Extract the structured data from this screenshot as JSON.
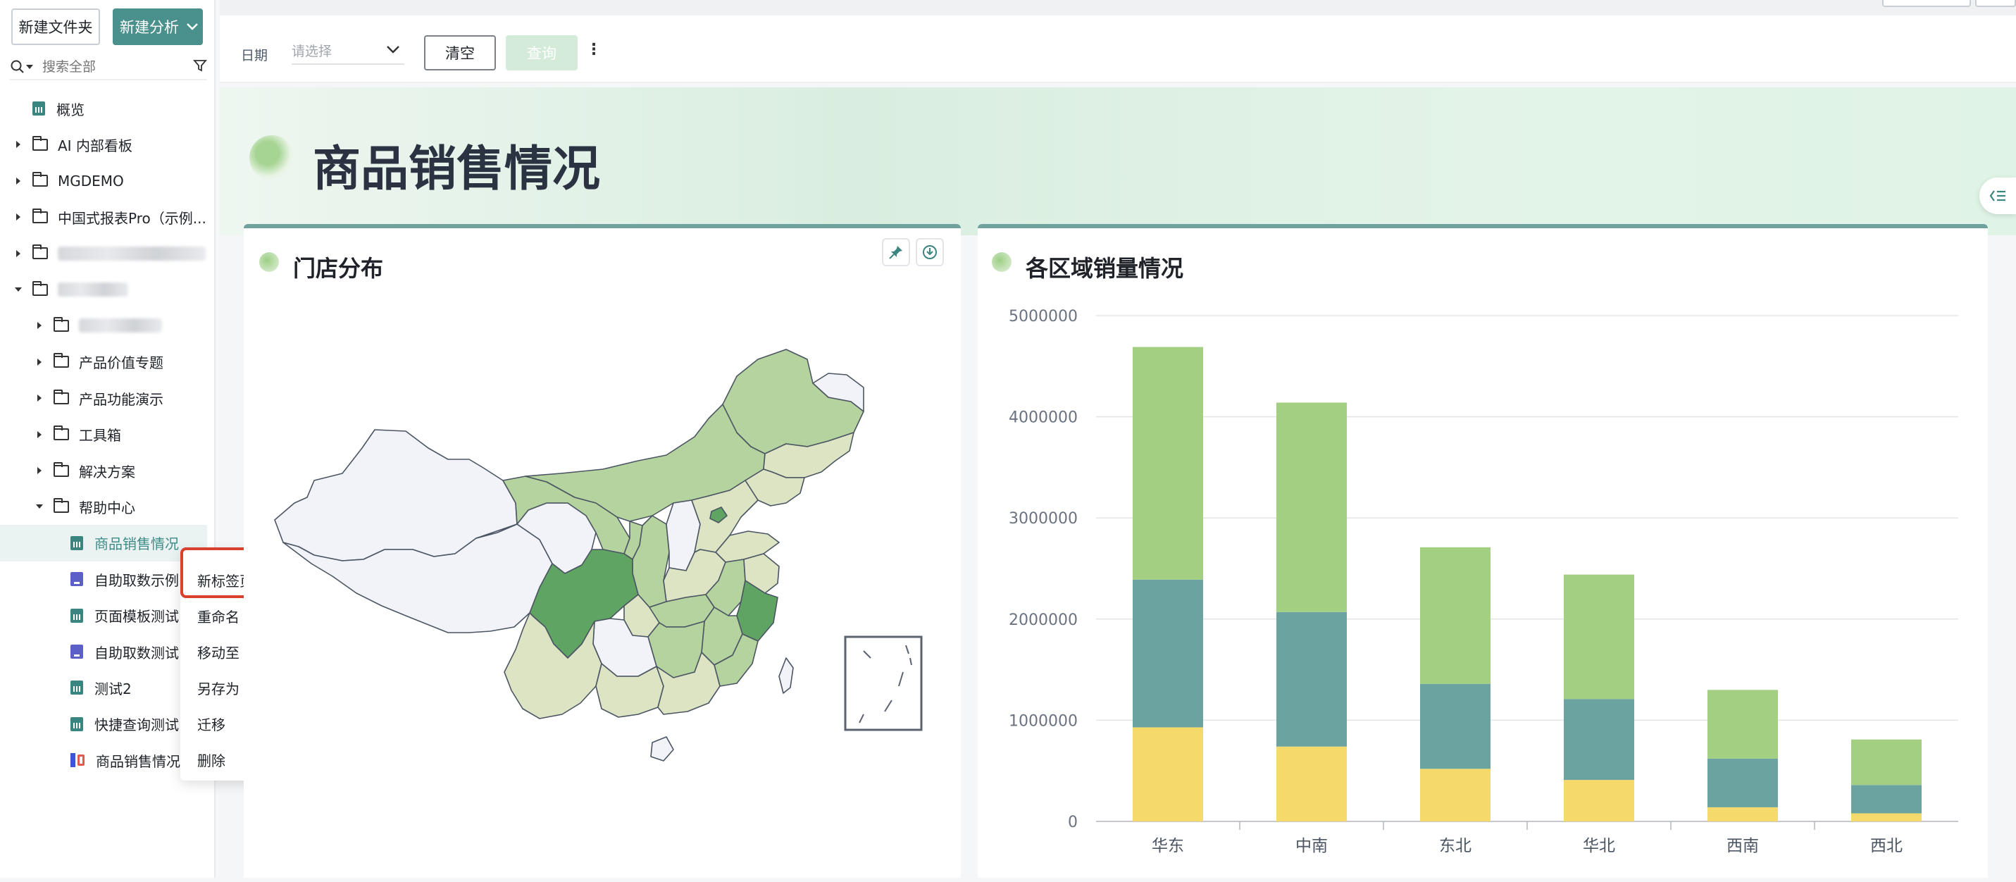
{
  "sidebar": {
    "new_folder": "新建文件夹",
    "new_analysis": "新建分析",
    "search_placeholder": "搜索全部",
    "items": [
      {
        "label": "概览",
        "type": "report",
        "depth": 0
      },
      {
        "label": "AI 内部看板",
        "type": "folder",
        "depth": 0
      },
      {
        "label": "MGDEMO",
        "type": "folder",
        "depth": 0
      },
      {
        "label": "中国式报表Pro（示例...",
        "type": "folder",
        "depth": 0
      },
      {
        "label": "",
        "type": "folder-blurred",
        "depth": 0
      },
      {
        "label": "",
        "type": "folder-blurred-open",
        "depth": 0
      },
      {
        "label": "",
        "type": "folder-blurred",
        "depth": 1
      },
      {
        "label": "产品价值专题",
        "type": "folder",
        "depth": 1
      },
      {
        "label": "产品功能演示",
        "type": "folder",
        "depth": 1
      },
      {
        "label": "工具箱",
        "type": "folder",
        "depth": 1
      },
      {
        "label": "解决方案",
        "type": "folder",
        "depth": 1
      },
      {
        "label": "帮助中心",
        "type": "folder-open",
        "depth": 1
      },
      {
        "label": "商品销售情况",
        "type": "report",
        "depth": 2,
        "active": true
      },
      {
        "label": "自助取数示例",
        "type": "fetch",
        "depth": 2
      },
      {
        "label": "页面模板测试",
        "type": "report",
        "depth": 2
      },
      {
        "label": "自助取数测试",
        "type": "fetch",
        "depth": 2
      },
      {
        "label": "测试2",
        "type": "report",
        "depth": 2
      },
      {
        "label": "快捷查询测试",
        "type": "report",
        "depth": 2
      },
      {
        "label": "商品销售情况-",
        "type": "dashboard",
        "depth": 2
      }
    ]
  },
  "context_menu": {
    "items": [
      "新标签页打开",
      "重命名",
      "移动至",
      "另存为",
      "迁移",
      "删除"
    ]
  },
  "filter": {
    "date_label": "日期",
    "date_placeholder": "请选择",
    "clear": "清空",
    "query": "查询"
  },
  "page": {
    "title": "商品销售情况",
    "map_card_title": "门店分布",
    "bar_card_title": "各区域销量情况"
  },
  "colors": {
    "accent": "#4a908d",
    "series": [
      "#f6d96b",
      "#6aa39f",
      "#a3cf82"
    ]
  },
  "chart_data": {
    "type": "bar",
    "stacked": true,
    "categories": [
      "华东",
      "中南",
      "东北",
      "华北",
      "西南",
      "西北"
    ],
    "series": [
      {
        "values": [
          930000,
          740000,
          520000,
          410000,
          140000,
          80000
        ]
      },
      {
        "values": [
          1460000,
          1330000,
          840000,
          800000,
          480000,
          280000
        ]
      },
      {
        "values": [
          2300000,
          2070000,
          1350000,
          1230000,
          680000,
          450000
        ]
      }
    ],
    "yticks": [
      "0",
      "1000000",
      "2000000",
      "3000000",
      "4000000",
      "5000000"
    ],
    "ylim": [
      0,
      5000000
    ],
    "grid": true
  }
}
